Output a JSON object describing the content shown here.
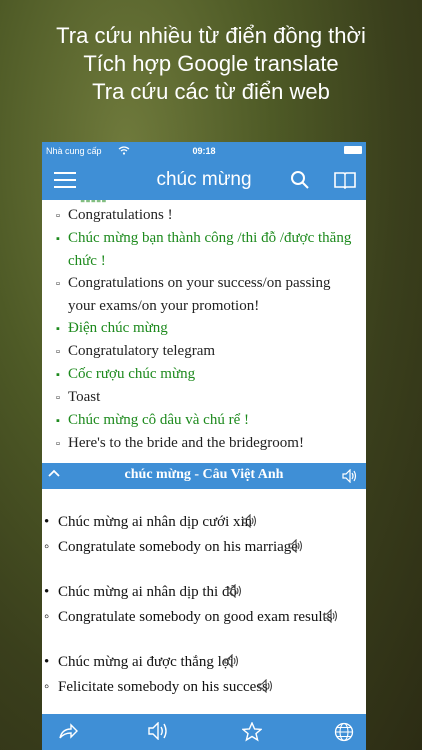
{
  "promo": {
    "line1": "Tra cứu nhiều từ điển đồng thời",
    "line2": "Tích hợp Google translate",
    "line3": "Tra cứu các từ điển web"
  },
  "status": {
    "carrier": "Nhà cung cấp",
    "time": "09:18"
  },
  "nav": {
    "title": "chúc mừng"
  },
  "entries": [
    {
      "kind": "en",
      "text": "Congratulations !"
    },
    {
      "kind": "vi",
      "text": "Chúc mừng bạn thành công /thi đỗ /được thăng chức !"
    },
    {
      "kind": "en",
      "text": "Congratulations on your success/on passing your exams/on your promotion!"
    },
    {
      "kind": "vi",
      "text": "Điện chúc mừng"
    },
    {
      "kind": "en",
      "text": "Congratulatory telegram"
    },
    {
      "kind": "vi",
      "text": "Cốc rượu chúc mừng"
    },
    {
      "kind": "en",
      "text": "Toast"
    },
    {
      "kind": "vi",
      "text": "Chúc mừng cô dâu và chú rể !"
    },
    {
      "kind": "en",
      "text": "Here's to the bride and the bridegroom!"
    }
  ],
  "section": {
    "title": "chúc mừng - Câu Việt Anh"
  },
  "phrases": [
    {
      "vi": "Chúc mừng ai nhân dịp cưới xin",
      "en": "Congratulate somebody on his marriage"
    },
    {
      "vi": "Chúc mừng ai nhân dịp thi đỗ",
      "en": "Congratulate somebody on good exam results"
    },
    {
      "vi": "Chúc mừng ai được thắng lợi",
      "en": "Felicitate somebody on his success"
    }
  ],
  "colors": {
    "accent": "#3f8fd6",
    "vietnamese_text": "#1d8a1d"
  },
  "icons": [
    "menu-icon",
    "search-icon",
    "book-icon",
    "share-icon",
    "speaker-icon",
    "star-icon",
    "globe-icon",
    "chevron-up-icon",
    "wifi-icon",
    "battery-icon"
  ]
}
